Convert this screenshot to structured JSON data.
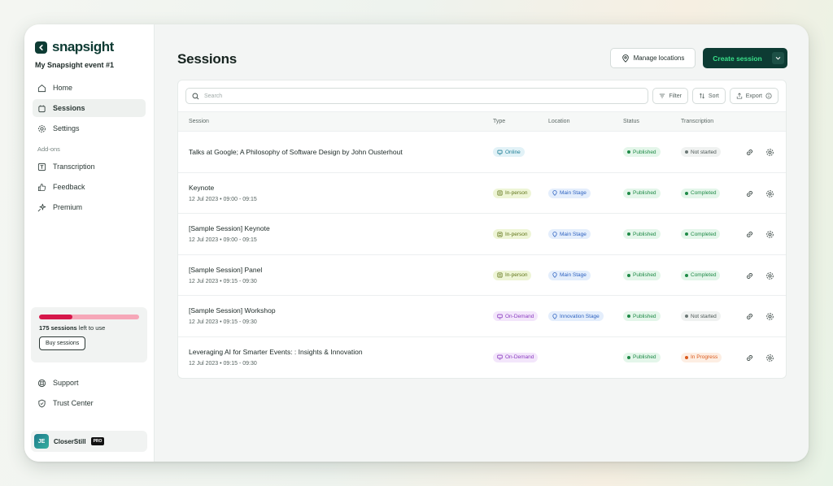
{
  "app": {
    "logo_text": "snapsight",
    "event_name": "My Snapsight event #1"
  },
  "sidebar": {
    "nav": [
      {
        "label": "Home",
        "icon": "home-icon",
        "active": false
      },
      {
        "label": "Sessions",
        "icon": "sessions-icon",
        "active": true
      },
      {
        "label": "Settings",
        "icon": "gear-icon",
        "active": false
      }
    ],
    "addons_label": "Add-ons",
    "addons": [
      {
        "label": "Transcription",
        "icon": "transcription-icon"
      },
      {
        "label": "Feedback",
        "icon": "thumbs-up-icon"
      },
      {
        "label": "Premium",
        "icon": "sparkle-icon"
      }
    ],
    "usage": {
      "count_text": "175 sessions",
      "suffix_text": "left to use",
      "progress_fraction": 0.33,
      "buy_label": "Buy sessions"
    },
    "bottom": [
      {
        "label": "Support",
        "icon": "support-icon"
      },
      {
        "label": "Trust Center",
        "icon": "shield-icon"
      }
    ],
    "user": {
      "initials": "JE",
      "name": "CloserStill",
      "badge": "PRO"
    }
  },
  "header": {
    "title": "Sessions",
    "manage_label": "Manage locations",
    "create_label": "Create session"
  },
  "toolbar": {
    "search_placeholder": "Search",
    "filter_label": "Filter",
    "sort_label": "Sort",
    "export_label": "Export"
  },
  "table": {
    "columns": [
      "Session",
      "Type",
      "Location",
      "Status",
      "Transcription"
    ],
    "rows": [
      {
        "title": "Talks at Google; A Philosophy of Software Design by John Ousterhout",
        "date": "",
        "type": "Online",
        "type_kind": "online",
        "location": "",
        "status": "Published",
        "transcription": "Not started",
        "tr_kind": "ns"
      },
      {
        "title": "Keynote",
        "date": "12 Jul 2023 • 09:00 - 09:15",
        "type": "In-person",
        "type_kind": "inperson",
        "location": "Main Stage",
        "status": "Published",
        "transcription": "Completed",
        "tr_kind": "done"
      },
      {
        "title": "[Sample Session] Keynote",
        "date": "12 Jul 2023 • 09:00 - 09:15",
        "type": "In-person",
        "type_kind": "inperson",
        "location": "Main Stage",
        "status": "Published",
        "transcription": "Completed",
        "tr_kind": "done"
      },
      {
        "title": "[Sample Session] Panel",
        "date": "12 Jul 2023 • 09:15 - 09:30",
        "type": "In-person",
        "type_kind": "inperson",
        "location": "Main Stage",
        "status": "Published",
        "transcription": "Completed",
        "tr_kind": "done"
      },
      {
        "title": "[Sample Session] Workshop",
        "date": "12 Jul 2023 • 09:15 - 09:30",
        "type": "On-Demand",
        "type_kind": "ondemand",
        "location": "Innovation Stage",
        "status": "Published",
        "transcription": "Not started",
        "tr_kind": "ns"
      },
      {
        "title": "Leveraging AI for Smarter Events: : Insights & Innovation",
        "date": "12 Jul 2023 • 09:15 - 09:30",
        "type": "On-Demand",
        "type_kind": "ondemand",
        "location": "",
        "status": "Published",
        "transcription": "In Progress",
        "tr_kind": "prog"
      }
    ]
  },
  "colors": {
    "brand_dark": "#0d3b33",
    "brand_green": "#39e08a",
    "progress_fill": "#d6174a",
    "progress_track": "#f6a7b8"
  }
}
